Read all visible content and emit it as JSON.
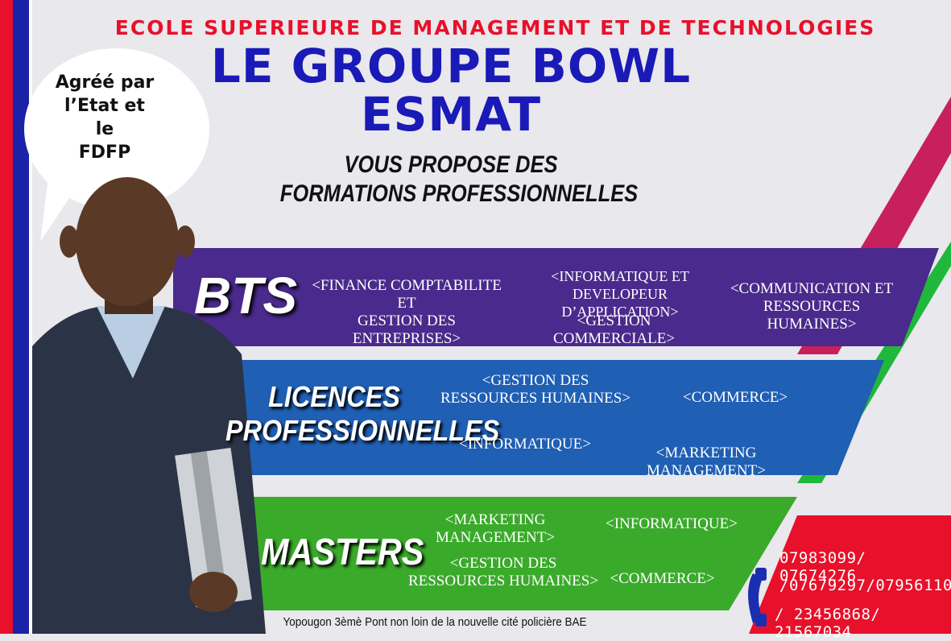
{
  "school_name": "ECOLE SUPERIEURE DE MANAGEMENT ET DE TECHNOLOGIES",
  "title_line1": "LE GROUPE BOWL",
  "title_line2": "ESMAT",
  "subtitle_line1": "VOUS PROPOSE DES",
  "subtitle_line2": "FORMATIONS PROFESSIONNELLES",
  "bubble": {
    "line1": "Agréé par",
    "line2": "l’Etat et",
    "line3": "le",
    "line4": "FDFP"
  },
  "bts": {
    "title": "BTS",
    "c1a": "<FINANCE COMPTABILITE ET",
    "c1b": "GESTION DES ENTREPRISES>",
    "c2a": "<INFORMATIQUE ET DEVELOPEUR",
    "c2b": "D’APPLICATION>",
    "c3": "<GESTION COMMERCIALE>",
    "c4a": "<COMMUNICATION ET",
    "c4b": "RESSOURCES HUMAINES>"
  },
  "licences": {
    "title1": "LICENCES",
    "title2": "PROFESSIONNELLES",
    "c1a": "<GESTION DES",
    "c1b": "RESSOURCES HUMAINES>",
    "c2": "<COMMERCE>",
    "c3": "<INFORMATIQUE>",
    "c4": "<MARKETING MANAGEMENT>"
  },
  "masters": {
    "title": "MASTERS",
    "c1": "<MARKETING MANAGEMENT>",
    "c2": "<INFORMATIQUE>",
    "c3a": "<GESTION DES",
    "c3b": "RESSOURCES HUMAINES>",
    "c4": "<COMMERCE>"
  },
  "contacts": {
    "line1": "07983099/ 07674276",
    "line2": "/07679297/07956110",
    "line3": "/ 23456868/ 21567034"
  },
  "address": "Yopougon 3èmè Pont non loin de la nouvelle cité policière BAE",
  "colors": {
    "red": "#e8102a",
    "blue_title": "#1a1ab8",
    "bts_band": "#4a2a8c",
    "licences_band": "#1f5fb4",
    "masters_band": "#3aaa2a"
  }
}
